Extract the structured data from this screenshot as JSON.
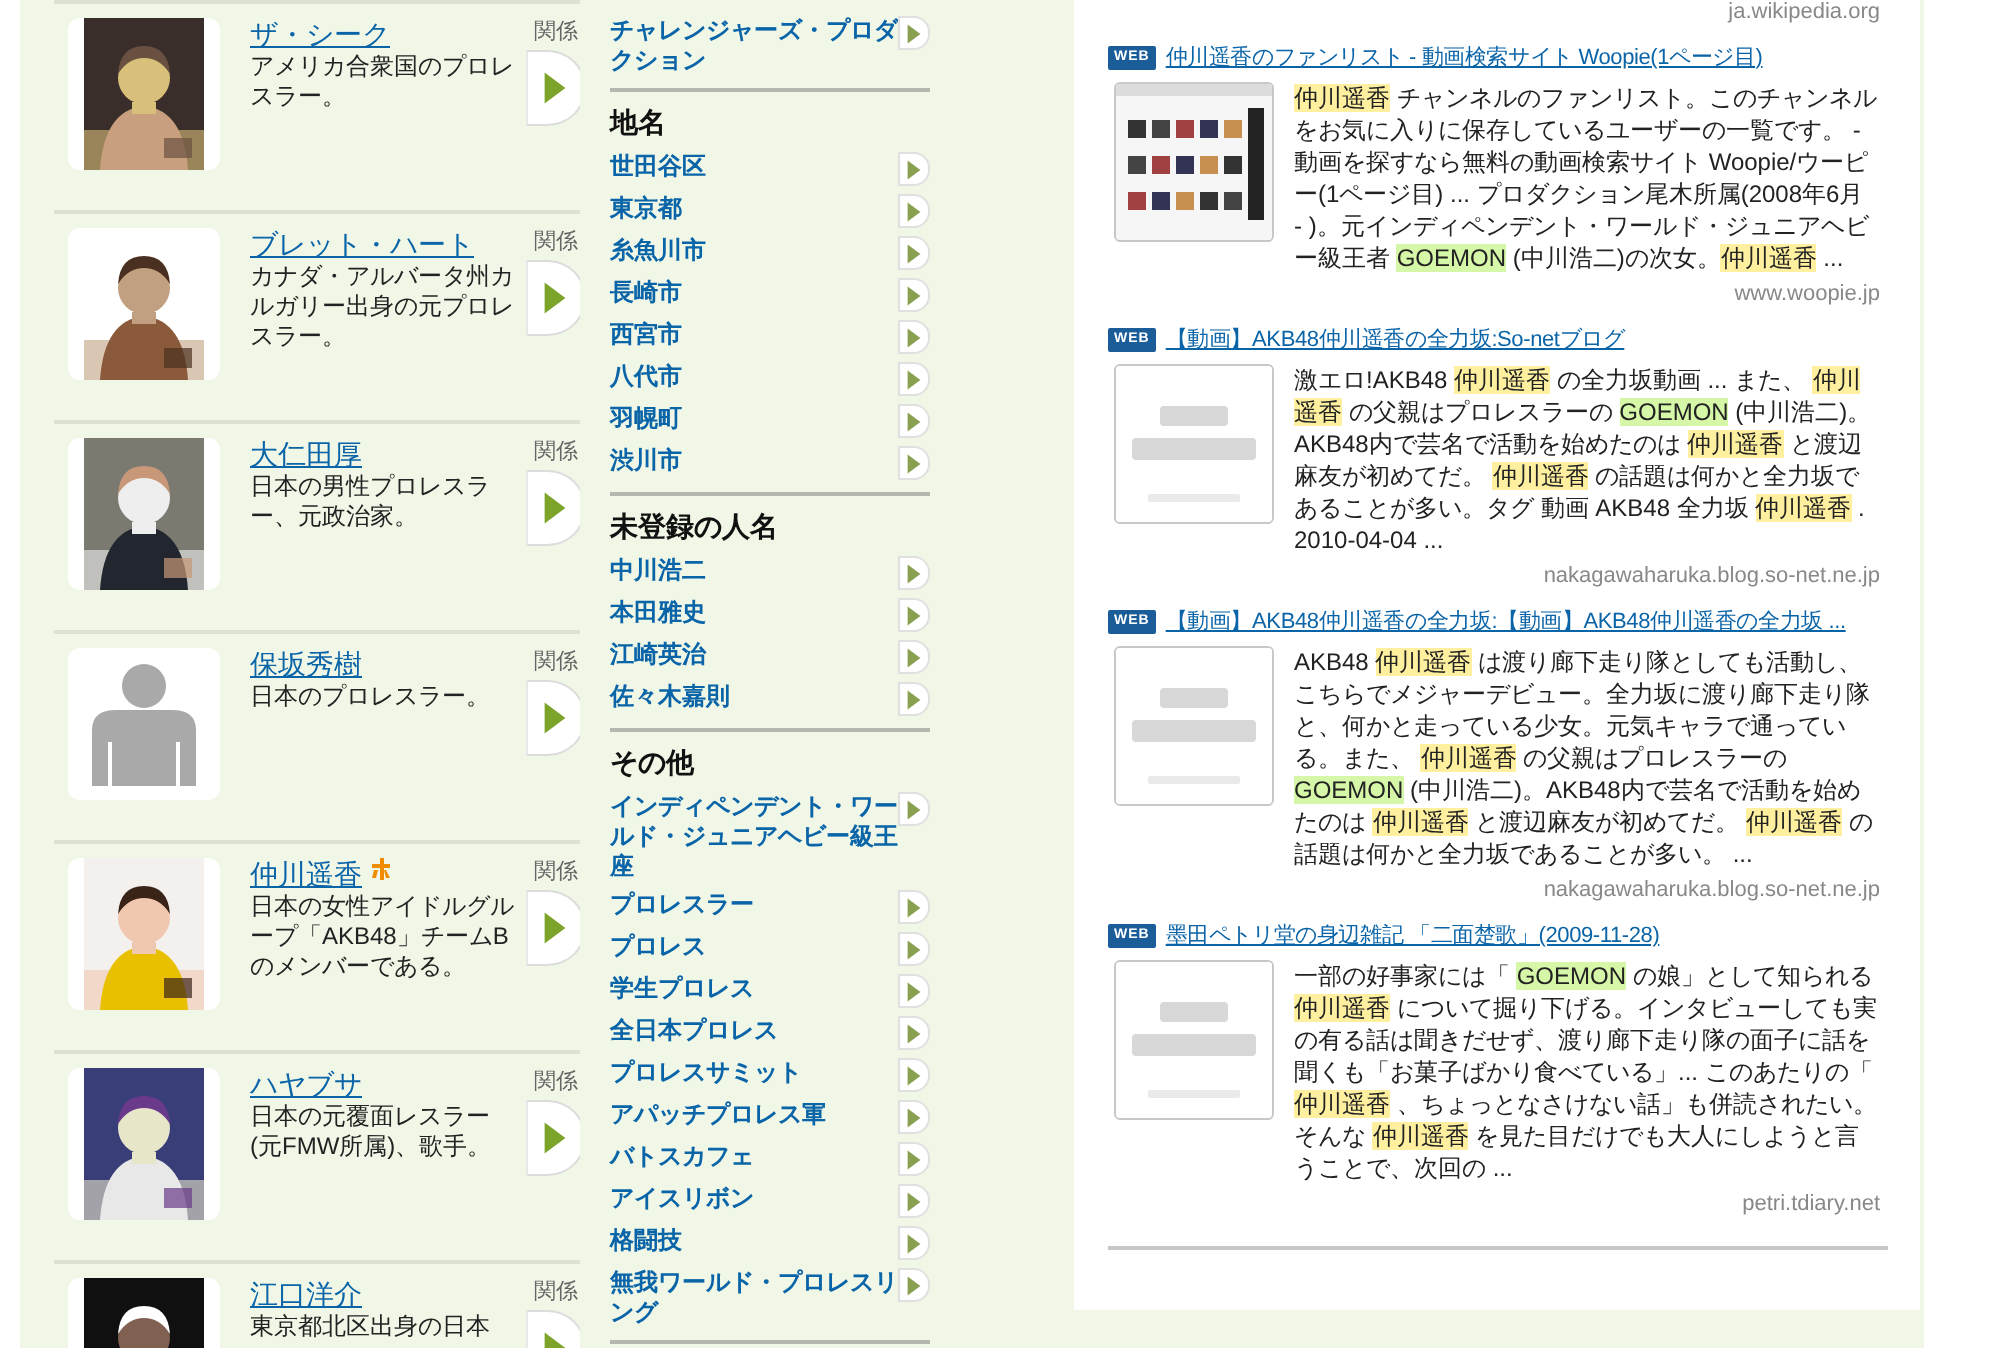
{
  "people": [
    {
      "name": "ザ・シーク",
      "description": "アメリカ合衆国のプロレスラー。",
      "badge": false,
      "relation_label": "関係"
    },
    {
      "name": "ブレット・ハート",
      "description": "カナダ・アルバータ州カルガリー出身の元プロレスラー。",
      "badge": false,
      "relation_label": "関係"
    },
    {
      "name": "大仁田厚",
      "description": "日本の男性プロレスラー、元政治家。",
      "badge": false,
      "relation_label": "関係"
    },
    {
      "name": "保坂秀樹",
      "description": "日本のプロレスラー。",
      "badge": false,
      "relation_label": "関係"
    },
    {
      "name": "仲川遥香",
      "description": "日本の女性アイドルグループ「AKB48」チームBのメンバーである。",
      "badge": true,
      "relation_label": "関係"
    },
    {
      "name": "ハヤブサ",
      "description": "日本の元覆面レスラー(元FMW所属)、歌手。",
      "badge": false,
      "relation_label": "関係"
    },
    {
      "name": "江口洋介",
      "description": "東京都北区出身の日本",
      "badge": false,
      "relation_label": "関係"
    }
  ],
  "categories": [
    {
      "items": [
        "チャレンジャーズ・プロダクション"
      ]
    },
    {
      "heading": "地名",
      "items": [
        "世田谷区",
        "東京都",
        "糸魚川市",
        "長崎市",
        "西宮市",
        "八代市",
        "羽幌町",
        "渋川市"
      ]
    },
    {
      "heading": "未登録の人名",
      "items": [
        "中川浩二",
        "本田雅史",
        "江崎英治",
        "佐々木嘉則"
      ]
    },
    {
      "heading": "その他",
      "items": [
        "インディペンデント・ワールド・ジュニアヘビー級王座",
        "プロレスラー",
        "プロレス",
        "学生プロレス",
        "全日本プロレス",
        "プロレスサミット",
        "アパッチプロレス軍",
        "バトスカフェ",
        "アイスリボン",
        "格闘技",
        "無我ワールド・プロレスリング"
      ]
    }
  ],
  "results": {
    "top_source": "ja.wikipedia.org",
    "items": [
      {
        "badge": "WEB",
        "title": "仲川遥香のファンリスト - 動画検索サイト Woopie(1ページ目)",
        "snippet": [
          {
            "kind": "query",
            "text": "仲川遥香"
          },
          {
            "kind": "plain",
            "text": " チャンネルのファンリスト。このチャンネルをお気に入りに保存しているユーザーの一覧です。 - 動画を探すなら無料の動画検索サイト Woopie/ウーピー(1ページ目) ... プロダクション尾木所属(2008年6月 - )。元インディペンデント・ワールド・ジュニアヘビー級王者 "
          },
          {
            "kind": "related",
            "text": "GOEMON"
          },
          {
            "kind": "plain",
            "text": " (中川浩二)の次女。"
          },
          {
            "kind": "query",
            "text": "仲川遥香"
          },
          {
            "kind": "plain",
            "text": " ..."
          }
        ],
        "source": "www.woopie.jp"
      },
      {
        "badge": "WEB",
        "title": "【動画】AKB48仲川遥香の全力坂:So-netブログ",
        "snippet": [
          {
            "kind": "plain",
            "text": "激エロ!AKB48 "
          },
          {
            "kind": "query",
            "text": "仲川遥香"
          },
          {
            "kind": "plain",
            "text": " の全力坂動画 ... また、 "
          },
          {
            "kind": "query",
            "text": "仲川遥香"
          },
          {
            "kind": "plain",
            "text": " の父親はプロレスラーの "
          },
          {
            "kind": "related",
            "text": "GOEMON"
          },
          {
            "kind": "plain",
            "text": " (中川浩二)。AKB48内で芸名で活動を始めたのは "
          },
          {
            "kind": "query",
            "text": "仲川遥香"
          },
          {
            "kind": "plain",
            "text": " と渡辺麻友が初めてだ。 "
          },
          {
            "kind": "query",
            "text": "仲川遥香"
          },
          {
            "kind": "plain",
            "text": " の話題は何かと全力坂であることが多い。タグ 動画 AKB48 全力坂 "
          },
          {
            "kind": "query",
            "text": "仲川遥香"
          },
          {
            "kind": "plain",
            "text": " . 2010-04-04 ..."
          }
        ],
        "source": "nakagawaharuka.blog.so-net.ne.jp"
      },
      {
        "badge": "WEB",
        "title": "【動画】AKB48仲川遥香の全力坂:【動画】AKB48仲川遥香の全力坂 ...",
        "snippet": [
          {
            "kind": "plain",
            "text": "AKB48 "
          },
          {
            "kind": "query",
            "text": "仲川遥香"
          },
          {
            "kind": "plain",
            "text": " は渡り廊下走り隊としても活動し、こちらでメジャーデビュー。全力坂に渡り廊下走り隊と、何かと走っている少女。元気キャラで通っている。また、 "
          },
          {
            "kind": "query",
            "text": "仲川遥香"
          },
          {
            "kind": "plain",
            "text": " の父親はプロレスラーの "
          },
          {
            "kind": "related",
            "text": "GOEMON"
          },
          {
            "kind": "plain",
            "text": " (中川浩二)。AKB48内で芸名で活動を始めたのは "
          },
          {
            "kind": "query",
            "text": "仲川遥香"
          },
          {
            "kind": "plain",
            "text": " と渡辺麻友が初めてだ。 "
          },
          {
            "kind": "query",
            "text": "仲川遥香"
          },
          {
            "kind": "plain",
            "text": " の話題は何かと全力坂であることが多い。 ..."
          }
        ],
        "source": "nakagawaharuka.blog.so-net.ne.jp"
      },
      {
        "badge": "WEB",
        "title": "墨田ペトリ堂の身辺雑記 「二面楚歌」(2009-11-28)",
        "snippet": [
          {
            "kind": "plain",
            "text": "一部の好事家には「 "
          },
          {
            "kind": "related",
            "text": "GOEMON"
          },
          {
            "kind": "plain",
            "text": " の娘」として知られる "
          },
          {
            "kind": "query",
            "text": "仲川遥香"
          },
          {
            "kind": "plain",
            "text": " について掘り下げる。インタビューしても実の有る話は聞きだせず、渡り廊下走り隊の面子に話を聞くも「お菓子ばかり食べている」... このあたりの「 "
          },
          {
            "kind": "query",
            "text": "仲川遥香"
          },
          {
            "kind": "plain",
            "text": " 、ちょっとなさけない話」も併読されたい。そんな "
          },
          {
            "kind": "query",
            "text": "仲川遥香"
          },
          {
            "kind": "plain",
            "text": " を見た目だけでも大人にしようと言うことで、次回の ..."
          }
        ],
        "source": "petri.tdiary.net"
      }
    ]
  }
}
